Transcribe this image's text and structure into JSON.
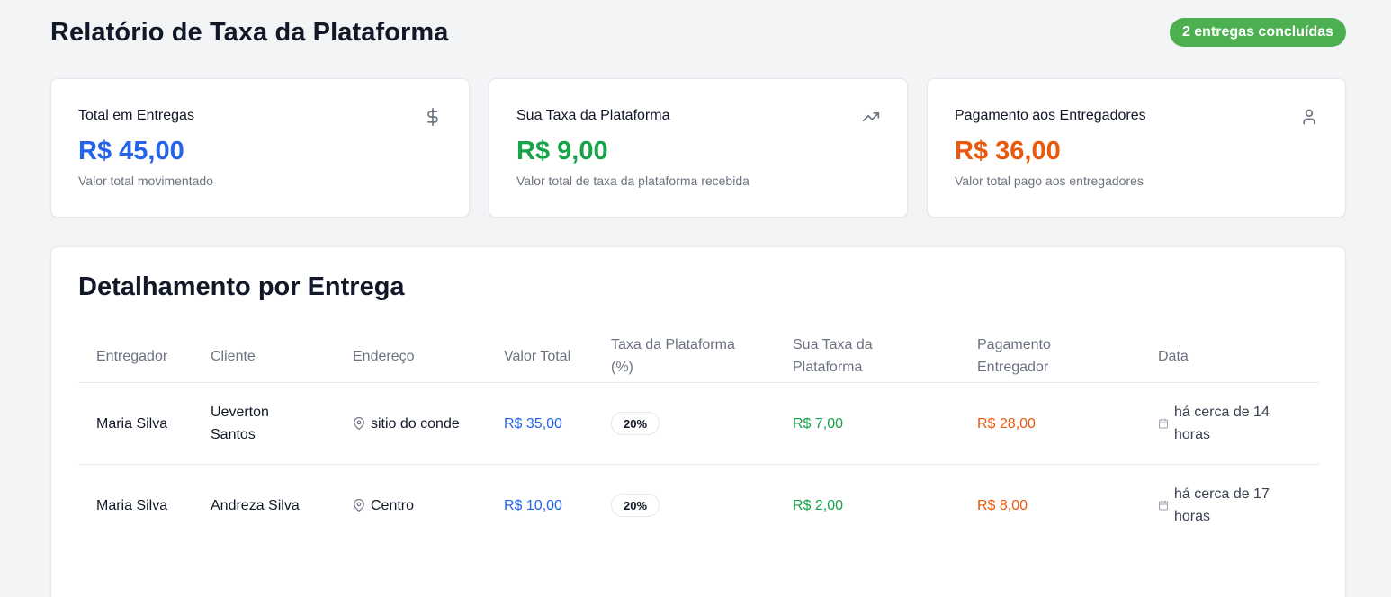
{
  "header": {
    "title": "Relatório de Taxa da Plataforma",
    "badge": "2 entregas concluídas"
  },
  "cards": [
    {
      "title": "Total em Entregas",
      "value": "R$ 45,00",
      "description": "Valor total movimentado",
      "icon": "dollar-icon",
      "color": "#2563eb"
    },
    {
      "title": "Sua Taxa da Plataforma",
      "value": "R$ 9,00",
      "description": "Valor total de taxa da plataforma recebida",
      "icon": "trending-up-icon",
      "color": "#16a34a"
    },
    {
      "title": "Pagamento aos Entregadores",
      "value": "R$ 36,00",
      "description": "Valor total pago aos entregadores",
      "icon": "user-icon",
      "color": "#ea580c"
    }
  ],
  "details": {
    "title": "Detalhamento por Entrega",
    "columns": [
      "Entregador",
      "Cliente",
      "Endereço",
      "Valor Total",
      "Taxa da Plataforma (%)",
      "Sua Taxa da Plataforma",
      "Pagamento Entregador",
      "Data"
    ],
    "rows": [
      {
        "courier": "Maria Silva",
        "client": "Ueverton Santos",
        "address": "sitio do conde",
        "total": "R$ 35,00",
        "rate": "20%",
        "fee": "R$ 7,00",
        "payout": "R$ 28,00",
        "date": "há cerca de 14 horas"
      },
      {
        "courier": "Maria Silva",
        "client": "Andreza Silva",
        "address": "Centro",
        "total": "R$ 10,00",
        "rate": "20%",
        "fee": "R$ 2,00",
        "payout": "R$ 8,00",
        "date": "há cerca de 17 horas"
      }
    ]
  }
}
